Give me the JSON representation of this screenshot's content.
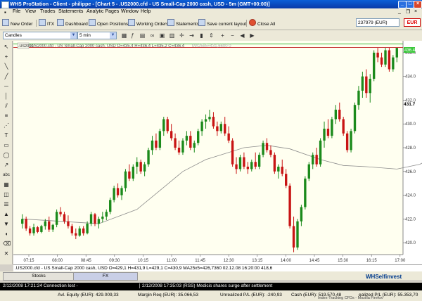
{
  "window": {
    "title": "WHS ProStation - Client - philippe - [Chart 5 - .US2000.cfd - US Small-Cap 2000 cash, USD - 5m (GMT+00:00)]",
    "controls": [
      "_",
      "□",
      "×"
    ]
  },
  "menu": [
    "File",
    "View",
    "Trades",
    "Statements",
    "Analytic Pages",
    "Window",
    "Help"
  ],
  "toolbar": {
    "buttons": [
      "New Order",
      "ITX",
      "Dashboard",
      "Open Positions",
      "Working Orders",
      "Statements",
      "Save current layout",
      "Close All"
    ],
    "account": "237979 (EUR)",
    "currency": "EUR"
  },
  "chart_toolbar": {
    "chart_type": "Candles",
    "interval": "5 min"
  },
  "chart_header": {
    "symbol_box": ".US2000",
    "info": ".US2000.cfd - US Small-Cap 2000 cash, USD O=435,4 H=436,4 L=435,2 C=436,4",
    "ma_info": "MA25x5=431,6600 0"
  },
  "status_line": ".US2000.cfd - US Small-Cap 2000 cash, USD O=429,1 H=431,9 L=429,1 C=430,9   MA25x5=426,7360   02.12.08 16:20:00 418,6",
  "price_badge": "431.7",
  "last_price": "436.4",
  "tabs": [
    "Stocks",
    "FX"
  ],
  "logo": "WHSelfinvest",
  "news": {
    "item1": "2/12/2008 17:21:24 Connection lost -",
    "item2": "2/12/2008 17:35:03 (RSS) Medicis shares surge after settlement"
  },
  "bottom": {
    "avl_equity": "Avl. Equity (EUR): 429.009,33",
    "margin_req": "Margin Req (EUR): 35.066,53",
    "unrealized": "Unrealized P/L (EUR): -240,93",
    "cash": "Cash (EUR): 519.570,48",
    "realized": "ealized P/L (EUR): 55.353,70",
    "index_tab": "Index-Tracking CFDs - Mozilla Firefox"
  },
  "chart_data": {
    "type": "candlestick",
    "title": "",
    "xlabel": "",
    "ylabel": "",
    "ylim": [
      419,
      437
    ],
    "y_ticks": [
      420.0,
      422.0,
      424.0,
      426.0,
      428.0,
      430.0,
      432.0,
      434.0,
      436.0
    ],
    "x_ticks": [
      "07:15",
      "08:00",
      "08:45",
      "09:30",
      "10:15",
      "11:00",
      "11:45",
      "12:30",
      "13:15",
      "14:00",
      "14:45",
      "15:30",
      "16:15",
      "17:00"
    ],
    "colors": {
      "up": "#1b8a1b",
      "down": "#c81414",
      "ma": "#8c8c8c",
      "background": "#fffff0"
    },
    "candles": [
      [
        421.6,
        422.4,
        421.2,
        422.0
      ],
      [
        422.0,
        422.2,
        421.0,
        421.2
      ],
      [
        421.2,
        421.4,
        420.6,
        420.8
      ],
      [
        420.8,
        421.6,
        420.6,
        421.3
      ],
      [
        421.3,
        421.4,
        420.8,
        420.9
      ],
      [
        420.9,
        421.5,
        420.8,
        421.4
      ],
      [
        421.4,
        422.0,
        421.1,
        421.8
      ],
      [
        421.8,
        422.2,
        420.9,
        421.1
      ],
      [
        421.1,
        421.6,
        420.9,
        421.5
      ],
      [
        421.5,
        422.8,
        421.3,
        422.6
      ],
      [
        422.6,
        423.0,
        422.2,
        422.4
      ],
      [
        422.4,
        422.6,
        421.6,
        421.8
      ],
      [
        421.8,
        422.3,
        421.2,
        421.4
      ],
      [
        421.4,
        421.6,
        420.6,
        420.8
      ],
      [
        420.8,
        421.2,
        420.3,
        420.6
      ],
      [
        420.6,
        421.4,
        420.5,
        421.2
      ],
      [
        421.2,
        421.4,
        420.6,
        420.8
      ],
      [
        420.8,
        421.8,
        420.7,
        421.6
      ],
      [
        421.6,
        422.6,
        421.4,
        422.4
      ],
      [
        422.4,
        422.5,
        421.4,
        421.6
      ],
      [
        421.6,
        422.2,
        421.2,
        422.0
      ],
      [
        422.0,
        422.6,
        421.7,
        422.2
      ],
      [
        422.2,
        422.8,
        421.9,
        422.6
      ],
      [
        422.6,
        423.8,
        422.4,
        423.6
      ],
      [
        423.6,
        424.8,
        423.4,
        424.6
      ],
      [
        424.6,
        425.0,
        423.8,
        424.0
      ],
      [
        424.0,
        424.8,
        423.6,
        424.6
      ],
      [
        424.6,
        426.2,
        424.3,
        426.0
      ],
      [
        426.0,
        426.6,
        425.2,
        425.4
      ],
      [
        425.4,
        426.6,
        425.2,
        426.4
      ],
      [
        426.4,
        427.2,
        425.8,
        426.8
      ],
      [
        426.8,
        427.0,
        425.8,
        426.0
      ],
      [
        426.0,
        426.8,
        425.6,
        426.6
      ],
      [
        426.6,
        428.0,
        426.4,
        427.8
      ],
      [
        427.8,
        429.0,
        427.4,
        428.6
      ],
      [
        428.6,
        429.2,
        427.8,
        428.0
      ],
      [
        428.0,
        429.6,
        427.8,
        429.4
      ],
      [
        429.4,
        430.6,
        429.0,
        430.4
      ],
      [
        430.4,
        430.6,
        429.2,
        429.4
      ],
      [
        429.4,
        430.0,
        428.6,
        428.8
      ],
      [
        428.8,
        429.2,
        427.8,
        428.0
      ],
      [
        428.0,
        428.6,
        427.4,
        427.6
      ],
      [
        427.6,
        428.8,
        427.4,
        428.6
      ],
      [
        428.6,
        429.4,
        428.2,
        429.0
      ],
      [
        429.0,
        429.4,
        427.8,
        428.0
      ],
      [
        428.0,
        428.6,
        427.6,
        428.4
      ],
      [
        428.4,
        429.6,
        428.2,
        429.4
      ],
      [
        429.4,
        430.4,
        429.0,
        430.2
      ],
      [
        430.2,
        430.8,
        429.6,
        430.4
      ],
      [
        430.4,
        431.2,
        430.2,
        430.6
      ],
      [
        430.6,
        431.0,
        429.6,
        429.8
      ],
      [
        429.8,
        430.2,
        429.0,
        429.4
      ],
      [
        429.4,
        430.2,
        429.2,
        430.0
      ],
      [
        430.0,
        430.6,
        429.0,
        429.2
      ],
      [
        429.2,
        429.8,
        428.4,
        428.6
      ],
      [
        428.6,
        428.8,
        426.4,
        426.6
      ],
      [
        426.6,
        427.2,
        425.8,
        426.2
      ],
      [
        426.2,
        427.4,
        426.0,
        427.2
      ],
      [
        427.2,
        427.6,
        426.2,
        426.4
      ],
      [
        426.4,
        426.8,
        425.8,
        426.2
      ],
      [
        426.2,
        427.0,
        426.0,
        426.8
      ],
      [
        426.8,
        427.6,
        426.2,
        426.4
      ],
      [
        426.4,
        427.6,
        426.2,
        427.4
      ],
      [
        427.4,
        428.6,
        427.2,
        428.4
      ],
      [
        428.4,
        428.8,
        427.6,
        427.8
      ],
      [
        427.8,
        428.2,
        427.2,
        427.4
      ],
      [
        427.4,
        427.6,
        425.8,
        426.0
      ],
      [
        426.0,
        426.6,
        425.4,
        426.4
      ],
      [
        426.4,
        427.0,
        425.6,
        425.8
      ],
      [
        425.8,
        426.2,
        424.6,
        424.8
      ],
      [
        424.8,
        425.0,
        421.2,
        421.4
      ],
      [
        421.4,
        422.2,
        419.2,
        419.6
      ],
      [
        419.6,
        422.0,
        419.4,
        421.8
      ],
      [
        421.8,
        423.2,
        421.4,
        423.0
      ],
      [
        423.0,
        425.6,
        422.8,
        425.4
      ],
      [
        425.4,
        426.8,
        425.2,
        426.6
      ],
      [
        426.6,
        427.6,
        426.2,
        427.4
      ],
      [
        427.4,
        428.0,
        426.4,
        426.6
      ],
      [
        426.6,
        428.8,
        426.4,
        428.6
      ],
      [
        428.6,
        430.2,
        428.0,
        429.6
      ],
      [
        429.6,
        430.4,
        428.8,
        429.0
      ],
      [
        429.0,
        430.6,
        428.8,
        430.4
      ],
      [
        430.4,
        431.6,
        430.0,
        431.2
      ],
      [
        431.2,
        431.8,
        430.2,
        430.4
      ],
      [
        430.4,
        430.6,
        429.0,
        429.2
      ],
      [
        429.2,
        429.4,
        427.6,
        427.8
      ],
      [
        427.8,
        429.6,
        427.6,
        429.4
      ],
      [
        429.4,
        431.8,
        429.2,
        431.6
      ],
      [
        431.6,
        433.2,
        431.2,
        432.8
      ],
      [
        432.8,
        434.4,
        432.2,
        434.0
      ],
      [
        434.0,
        434.6,
        432.2,
        432.6
      ],
      [
        432.6,
        434.2,
        431.8,
        433.8
      ],
      [
        433.8,
        436.2,
        433.6,
        436.0
      ],
      [
        436.0,
        436.4,
        435.2,
        435.6
      ],
      [
        435.6,
        436.0,
        434.8,
        435.0
      ],
      [
        435.0,
        436.4,
        434.8,
        436.2
      ],
      [
        436.2,
        436.4,
        434.4,
        434.6
      ],
      [
        434.6,
        435.8,
        434.4,
        435.6
      ],
      [
        435.6,
        436.4,
        435.2,
        436.4
      ]
    ],
    "ma_label": "MA25x5",
    "ma": [
      [
        0,
        422.0
      ],
      [
        10,
        421.8
      ],
      [
        20,
        421.6
      ],
      [
        30,
        422.8
      ],
      [
        36,
        424.4
      ],
      [
        42,
        426.0
      ],
      [
        48,
        427.0
      ],
      [
        54,
        427.6
      ],
      [
        58,
        428.0
      ],
      [
        64,
        428.2
      ],
      [
        70,
        427.9
      ],
      [
        78,
        427.0
      ],
      [
        84,
        426.5
      ],
      [
        90,
        426.4
      ],
      [
        98,
        426.2
      ],
      [
        104,
        426.6
      ],
      [
        110,
        427.6
      ],
      [
        116,
        428.8
      ],
      [
        122,
        430.2
      ],
      [
        128,
        431.0
      ]
    ]
  }
}
